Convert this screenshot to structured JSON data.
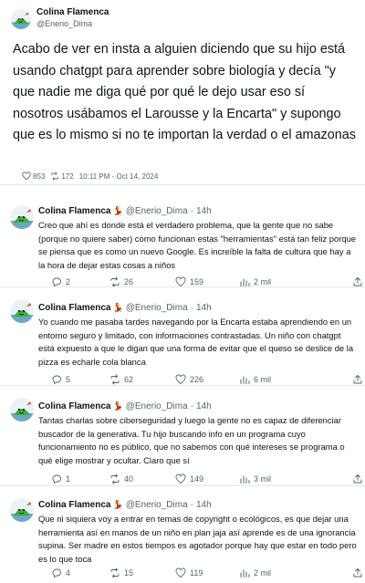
{
  "main": {
    "name": "Colina Flamenca",
    "handle": "@Enerio_Dima",
    "body": "Acabo de ver en insta a alguien diciendo que su hijo está usando chatgpt para aprender sobre biología y decía \"y que nadie me diga qué por qué le dejo usar eso sí nosotros usábamos el Larousse y la Encarta\" y supongo que es lo mismo si no te importan la verdad o el amazonas",
    "likes": "853",
    "retweets": "172",
    "timestamp": "10:11 PM - Oct 14, 2024"
  },
  "colors": {
    "text": "#0f1419",
    "muted": "#536471",
    "divider": "#e4e8eb",
    "avatar_green": "#3fae3a"
  },
  "icons": [
    "heart-icon",
    "retweet-icon",
    "reply-icon",
    "views-icon",
    "share-icon",
    "dancer-emoji"
  ],
  "replies": [
    {
      "name": "Colina Flamenca",
      "emoji": "💃",
      "handle": "@Enerio_Dima",
      "dot": "·",
      "time": "14h",
      "text": "Creo que ahí es donde está el verdadero problema, que la gente que no sabe (porque no quiere saber) cómo funcionan estas \"herramientas\" está tan feliz porque se piensa que es como un nuevo Google. Es increíble la falta de cultura que hay a la hora de dejar estas cosas a niños",
      "replies": "2",
      "retweets": "26",
      "likes": "159",
      "views": "2 mil"
    },
    {
      "name": "Colina Flamenca",
      "emoji": "💃",
      "handle": "@Enerio_Dima",
      "dot": "·",
      "time": "14h",
      "text": "Yo cuando me pasaba tardes navegando por la Encarta estaba aprendiendo en un entorno seguro y limitado, con informaciones contrastadas. Un niño con chatgpt está expuesto a que le digan que una forma de evitar que el queso se deslice de la pizza es echarle cola blanca",
      "replies": "5",
      "retweets": "62",
      "likes": "226",
      "views": "6 mil"
    },
    {
      "name": "Colina Flamenca",
      "emoji": "💃",
      "handle": "@Enerio_Dima",
      "dot": "·",
      "time": "14h",
      "text": "Tantas charlas sobre ciberseguridad y luego la gente no es capaz de diferenciar buscador de la generativa. Tu hijo buscando info en un programa cuyo funcionamiento no es público, que no sabemos con qué intereses se programa o qué elige mostrar y ocultar. Claro que sí",
      "replies": "1",
      "retweets": "40",
      "likes": "149",
      "views": "3 mil"
    },
    {
      "name": "Colina Flamenca",
      "emoji": "💃",
      "handle": "@Enerio_Dima",
      "dot": "·",
      "time": "14h",
      "text": "Que ni siquiera voy a entrar en temas de copyright o ecológicos, es que dejar una herramienta así en manos de un niño en plan jaja así aprende es de una ignorancia supina. Ser madre en estos tiempos es agotador porque hay que estar en todo pero es lo que toca",
      "replies": "4",
      "retweets": "15",
      "likes": "119",
      "views": "2 mil"
    }
  ]
}
